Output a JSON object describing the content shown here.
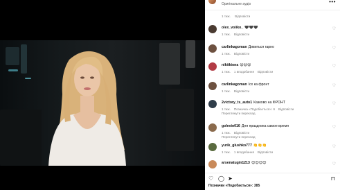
{
  "post": {
    "author": "...",
    "audio": "Оригінальне аудіо"
  },
  "top_meta": {
    "time": "1 тиж.",
    "reply": "Відповісти"
  },
  "comments": [
    {
      "user": "olex_voiiko_",
      "text": "🖤🖤🖤",
      "time": "1 тиж.",
      "likes": "",
      "reply": "Відповісти",
      "avatar_color": "#4a3b31"
    },
    {
      "user": "carlinkagoman",
      "text": "Дивиться гарно",
      "time": "1 тиж.",
      "likes": "",
      "reply": "Відповісти",
      "avatar_color": "#6d5140"
    },
    {
      "user": "nikitkiona",
      "text": "😍😍😍",
      "time": "1 тиж.",
      "likes": "1 вподобання",
      "reply": "Відповісти",
      "avatar_color": "#b23b45"
    },
    {
      "user": "carlinkagoman",
      "text": "Ісх ка фронт",
      "time": "1 тиж.",
      "likes": "",
      "reply": "Відповісти",
      "avatar_color": "#6d5140"
    },
    {
      "user": "2victory_ts_auto1",
      "text": "Казково на ФРОНТ",
      "time": "1 тиж.",
      "likes": "Позначка «Подобається»: 6",
      "reply": "Відповісти",
      "translate": "Переглянути переклад",
      "avatar_color": "#2f3d4a"
    },
    {
      "user": "golevin016",
      "text": "Для праздника самое время",
      "time": "1 тиж.",
      "likes": "",
      "reply": "Відповісти",
      "translate": "Переглянути переклад",
      "avatar_color": "#8a6a4c"
    },
    {
      "user": "yurik_glushko777",
      "text": "👏👏👏",
      "time": "1 тиж.",
      "likes": "1 вподобання",
      "reply": "Відповісти",
      "avatar_color": "#5a6b3f"
    },
    {
      "user": "arsenatugin1213",
      "text": "😍😍😍😍",
      "time": "",
      "likes": "",
      "reply": "",
      "avatar_color": "#c98a5a"
    }
  ],
  "likes_summary": "Позначки «Подобається»: 385",
  "icons": [
    "more-icon",
    "heart-icon",
    "comment-icon",
    "share-icon",
    "bookmark-icon"
  ]
}
